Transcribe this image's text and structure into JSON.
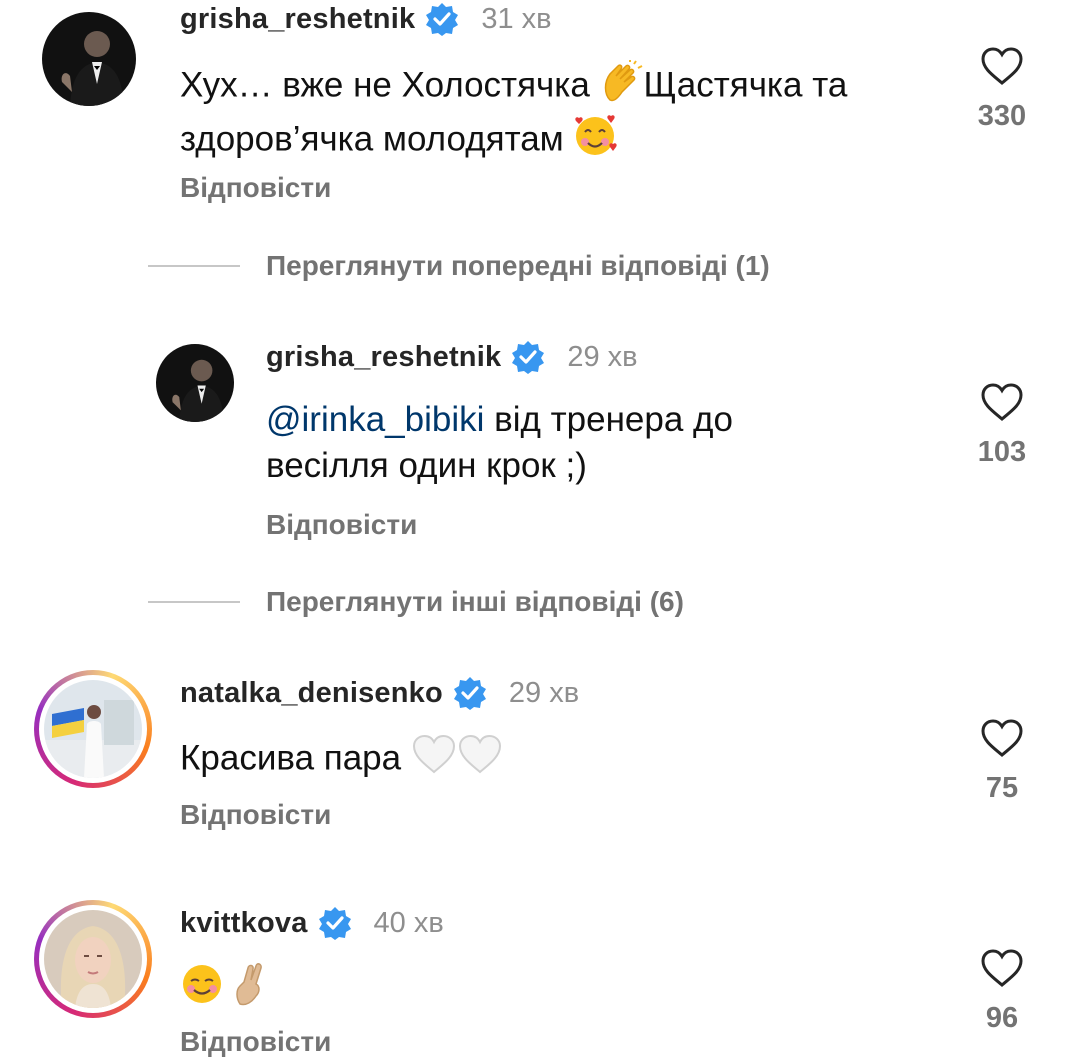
{
  "comments": [
    {
      "username": "grisha_reshetnik",
      "time": "31 хв",
      "text_line1_a": "Хух… вже не Холостячка ",
      "text_line1_b": "Щастячка та",
      "text_line2": "здоров’ячка молодятам ",
      "reply_label": "Відповісти",
      "likes": "330",
      "emojis": [
        "clapping-hands",
        "smiling-face-with-hearts"
      ]
    },
    {
      "username": "grisha_reshetnik",
      "time": "29 хв",
      "mention": "@irinka_bibiki",
      "text_line1": " від тренера до",
      "text_line2": "весілля один крок ;)",
      "reply_label": "Відповісти",
      "likes": "103"
    },
    {
      "username": "natalka_denisenko",
      "time": "29 хв",
      "text": "Красива пара ",
      "reply_label": "Відповісти",
      "likes": "75",
      "emojis": [
        "white-heart",
        "white-heart"
      ]
    },
    {
      "username": "kvittkova",
      "time": "40 хв",
      "reply_label": "Відповісти",
      "likes": "96",
      "emojis": [
        "smiling-face",
        "crossed-fingers"
      ]
    }
  ],
  "view_previous_replies": "Переглянути попередні відповіді (1)",
  "view_other_replies": "Переглянути інші відповіді (6)",
  "colors": {
    "verified": "#3897f0",
    "mention": "#00376b",
    "secondary_text": "#737373",
    "story_ring_start": "#d62976",
    "story_ring_end": "#feda75"
  }
}
